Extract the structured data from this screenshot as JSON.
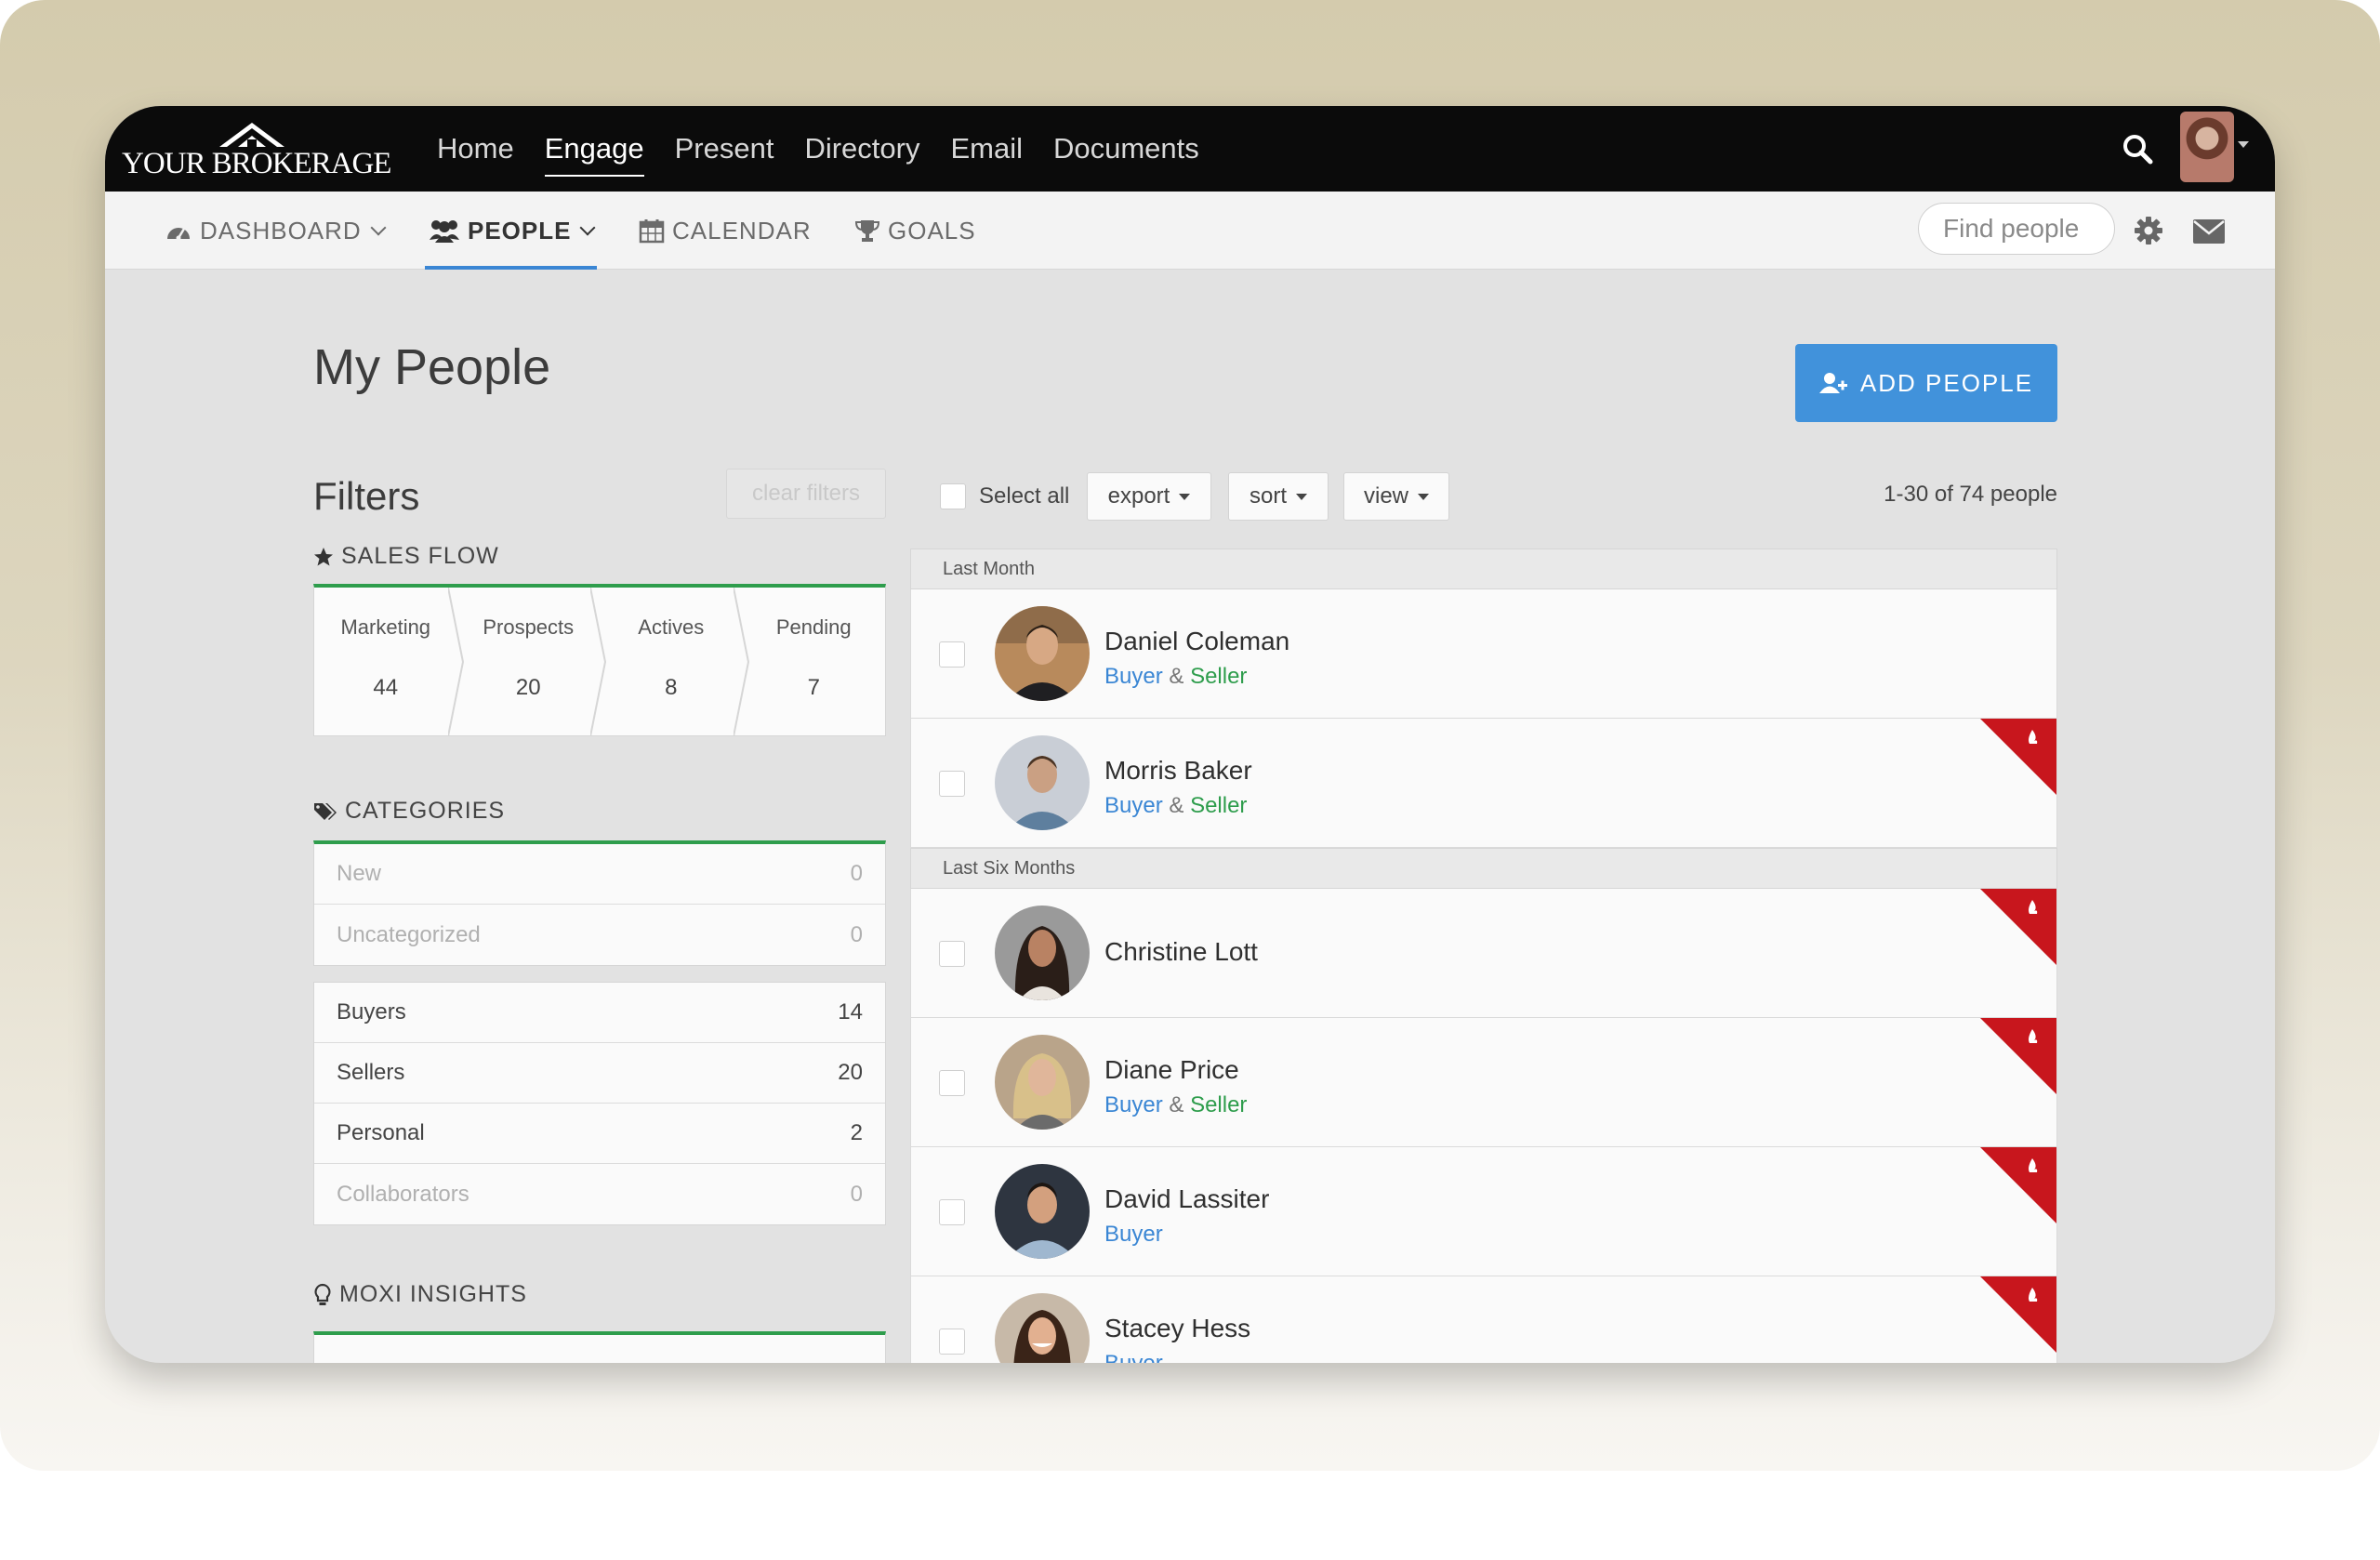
{
  "brand": {
    "logo_text": "YOUR BROKERAGE"
  },
  "main_nav": [
    "Home",
    "Engage",
    "Present",
    "Directory",
    "Email",
    "Documents"
  ],
  "main_nav_active": "Engage",
  "sub_nav": {
    "dashboard": "DASHBOARD",
    "people": "PEOPLE",
    "calendar": "CALENDAR",
    "goals": "GOALS",
    "search_placeholder": "Find people"
  },
  "page": {
    "title": "My People",
    "add_button": "ADD PEOPLE"
  },
  "filters": {
    "title": "Filters",
    "clear": "clear filters",
    "sales_flow": {
      "heading": "SALES FLOW",
      "stages": [
        {
          "label": "Marketing",
          "count": "44"
        },
        {
          "label": "Prospects",
          "count": "20"
        },
        {
          "label": "Actives",
          "count": "8"
        },
        {
          "label": "Pending",
          "count": "7"
        }
      ]
    },
    "categories": {
      "heading": "CATEGORIES",
      "group1": [
        {
          "label": "New",
          "count": "0"
        },
        {
          "label": "Uncategorized",
          "count": "0"
        }
      ],
      "group2": [
        {
          "label": "Buyers",
          "count": "14"
        },
        {
          "label": "Sellers",
          "count": "20"
        },
        {
          "label": "Personal",
          "count": "2"
        },
        {
          "label": "Collaborators",
          "count": "0"
        }
      ]
    },
    "insights": {
      "heading": "MOXI INSIGHTS"
    }
  },
  "toolbar": {
    "select_all": "Select all",
    "export": "export",
    "sort": "sort",
    "view": "view",
    "count": "1-30 of 74 people"
  },
  "groups": [
    {
      "label": "Last Month",
      "people": [
        {
          "name": "Daniel Coleman",
          "buyer": "Buyer",
          "amp": "&",
          "seller": "Seller",
          "flag": false
        },
        {
          "name": "Morris Baker",
          "buyer": "Buyer",
          "amp": "&",
          "seller": "Seller",
          "flag": true
        }
      ]
    },
    {
      "label": "Last Six Months",
      "people": [
        {
          "name": "Christine Lott",
          "buyer": "",
          "amp": "",
          "seller": "",
          "flag": true
        },
        {
          "name": "Diane Price",
          "buyer": "Buyer",
          "amp": "&",
          "seller": "Seller",
          "flag": true
        },
        {
          "name": "David Lassiter",
          "buyer": "Buyer",
          "amp": "",
          "seller": "",
          "flag": true
        },
        {
          "name": "Stacey Hess",
          "buyer": "Buyer",
          "amp": "",
          "seller": "",
          "flag": true
        }
      ]
    }
  ],
  "colors": {
    "accent_blue": "#4192db",
    "green": "#2e9d4c",
    "flag_red": "#c8161d"
  }
}
